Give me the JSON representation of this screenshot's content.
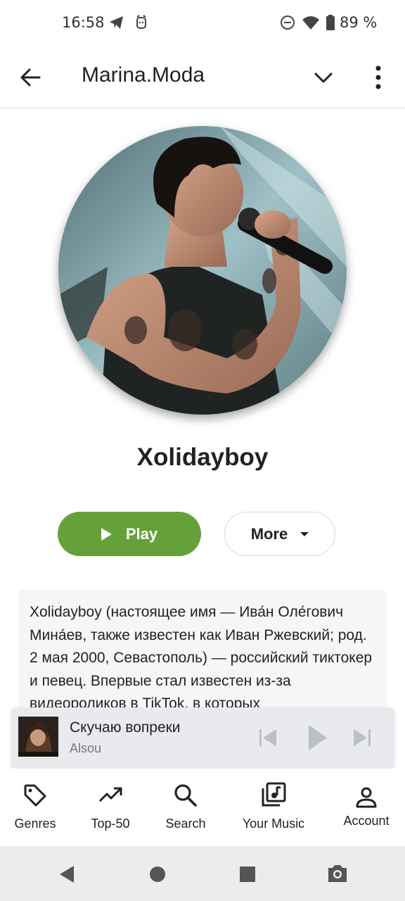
{
  "status_bar": {
    "time": "16:58",
    "battery": "89 %",
    "icons": [
      "telegram-icon",
      "alarm-icon",
      "dnd-icon",
      "wifi-icon",
      "battery-icon"
    ]
  },
  "app_bar": {
    "title": "Marina.Moda",
    "icons": [
      "back-arrow-icon",
      "chevron-down-icon",
      "more-vert-icon"
    ]
  },
  "artist": {
    "name": "Xolidayboy",
    "photo": "artist-photo-singer-microphone"
  },
  "actions": {
    "play_label": "Play",
    "more_label": "More"
  },
  "bio": {
    "text": "Xolidayboy (настоящее имя — Ива́н Оле́гович Мина́ев, также известен как Иван Ржевский; род. 2 мая 2000, Севастополь) — российский тиктокер и певец. Впервые стал известен из-за видеороликов в TikTok, в которых"
  },
  "now_playing": {
    "title": "Скучаю вопреки",
    "artist": "Alsou",
    "controls": [
      "skip-previous-icon",
      "play-icon",
      "skip-next-icon"
    ]
  },
  "bottom_nav": {
    "items": [
      {
        "label": "Genres",
        "icon": "tag-icon"
      },
      {
        "label": "Top-50",
        "icon": "trending-up-icon"
      },
      {
        "label": "Search",
        "icon": "search-icon"
      },
      {
        "label": "Your Music",
        "icon": "music-library-icon"
      },
      {
        "label": "Account",
        "icon": "person-icon"
      }
    ]
  },
  "system_nav": [
    "nav-back-icon",
    "nav-home-icon",
    "nav-recents-icon",
    "screenshot-icon"
  ],
  "colors": {
    "accent": "#65a13a",
    "bio_bg": "#f5f6f8",
    "player_bg": "#e8eaed"
  }
}
